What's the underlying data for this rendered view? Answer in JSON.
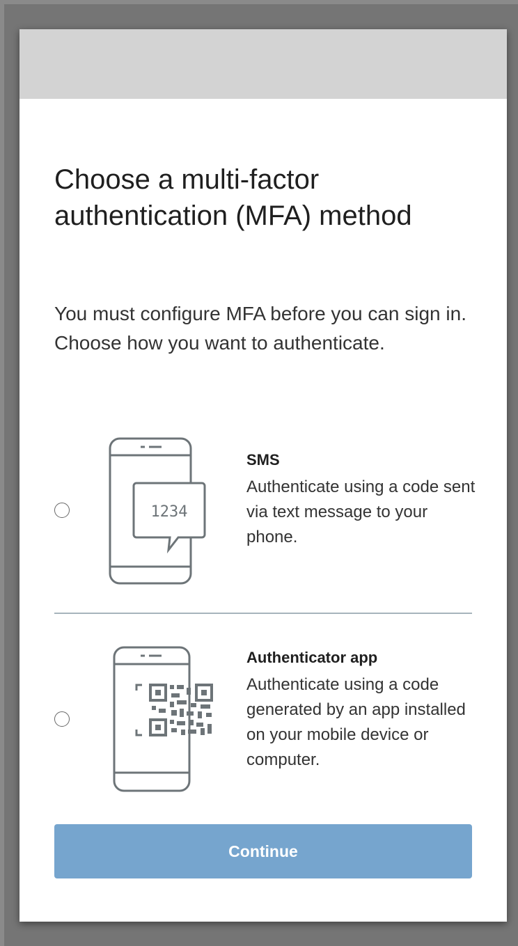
{
  "page": {
    "title": "Choose a multi-factor authentication (MFA) method",
    "description": "You must configure MFA before you can sign in. Choose how you want to authenticate."
  },
  "options": [
    {
      "id": "sms",
      "title": "SMS",
      "description": "Authenticate using a code sent via text message to your phone.",
      "illustration_text": "1234",
      "icon": "phone-sms-icon",
      "selected": false
    },
    {
      "id": "authenticator",
      "title": "Authenticator app",
      "description": "Authenticate using a code generated by an app installed on your mobile device or computer.",
      "icon": "phone-qr-code-icon",
      "selected": false
    }
  ],
  "actions": {
    "continue_label": "Continue"
  },
  "colors": {
    "header_bar": "#d3d3d3",
    "button": "#76a5ce",
    "divider": "#a7b4bc",
    "illustration_stroke": "#6d7478"
  }
}
